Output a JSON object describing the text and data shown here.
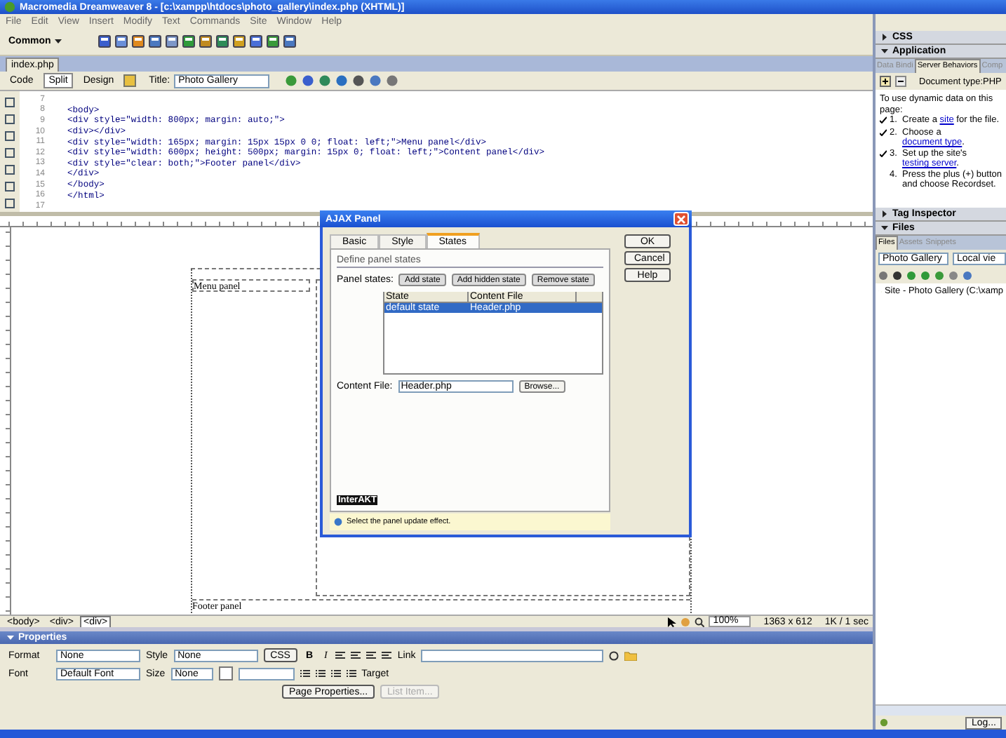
{
  "window": {
    "title": "Macromedia Dreamweaver 8 - [c:\\xampp\\htdocs\\photo_gallery\\index.php (XHTML)]"
  },
  "menu": [
    "File",
    "Edit",
    "View",
    "Insert",
    "Modify",
    "Text",
    "Commands",
    "Site",
    "Window",
    "Help"
  ],
  "insert_bar": {
    "category": "Common"
  },
  "document": {
    "tab": "index.php",
    "views": [
      {
        "label": "Code",
        "selected": false
      },
      {
        "label": "Split",
        "selected": true
      },
      {
        "label": "Design",
        "selected": false
      }
    ],
    "title_label": "Title:",
    "title_value": "Photo Gallery"
  },
  "code_view": {
    "lines": [
      {
        "number": "7"
      },
      {
        "number": "8",
        "text": "<body>"
      },
      {
        "number": "9",
        "text": "<div style=\"width: 800px; margin: auto;\">"
      },
      {
        "number": "10",
        "text": "<div></div>"
      },
      {
        "number": "11",
        "text": "<div style=\"width: 165px; margin: 15px 15px 0 0; float: left;\">Menu panel</div>"
      },
      {
        "number": "12",
        "text": "<div style=\"width: 600px; height: 500px; margin: 15px 0; float: left;\">Content panel</div>"
      },
      {
        "number": "13",
        "text": "<div style=\"clear: both;\">Footer panel</div>"
      },
      {
        "number": "14",
        "text": "</div>"
      },
      {
        "number": "15",
        "text": "</body>"
      },
      {
        "number": "16",
        "text": "</html>"
      },
      {
        "number": "17"
      }
    ]
  },
  "design_view": {
    "menu_panel": "Menu panel",
    "footer_panel": "Footer panel"
  },
  "status_bar": {
    "tags": [
      {
        "label": "<body>",
        "selected": false
      },
      {
        "label": "<div>",
        "selected": false
      },
      {
        "label": "<div>",
        "selected": true
      }
    ],
    "zoom": "100%",
    "window_size": "1363 x 612",
    "download": "1K / 1 sec"
  },
  "properties": {
    "title": "Properties",
    "expanded": true,
    "format_label": "Format",
    "format": "None",
    "style_label": "Style",
    "style": "None",
    "css_button": "CSS",
    "bold": "B",
    "italic": "I",
    "link_label": "Link",
    "font_label": "Font",
    "font": "Default Font",
    "size_label": "Size",
    "size": "None",
    "target_label": "Target",
    "page_properties": "Page Properties...",
    "list_item": {
      "label": "List Item...",
      "disabled": true
    }
  },
  "panels": [
    {
      "title": "CSS",
      "expanded": false
    },
    {
      "kind": "application",
      "title": "Application",
      "expanded": true,
      "tabs": [
        {
          "label": "Data Bindi",
          "selected": false
        },
        {
          "label": "Server Behaviors",
          "selected": true
        },
        {
          "label": "Comp",
          "selected": false
        }
      ],
      "document_type": "Document type:PHP",
      "intro": "To use dynamic data on this page:",
      "steps": [
        {
          "number": "1.",
          "checked": true,
          "before": "Create a ",
          "link": "site",
          "after": " for the file."
        },
        {
          "number": "2.",
          "checked": true,
          "before": "Choose a ",
          "link": "document type",
          "after": "."
        },
        {
          "number": "3.",
          "checked": true,
          "before": "Set up the site's ",
          "link": "testing server",
          "after": "."
        },
        {
          "number": "4.",
          "checked": false,
          "before": "Press the plus (+) button and choose Recordset."
        }
      ]
    },
    {
      "title": "Tag Inspector",
      "expanded": false
    },
    {
      "kind": "files",
      "title": "Files",
      "expanded": true,
      "tabs": [
        {
          "label": "Files",
          "selected": true
        },
        {
          "label": "Assets",
          "selected": false
        },
        {
          "label": "Snippets",
          "selected": false
        }
      ],
      "site": "Photo Gallery",
      "view": "Local vie",
      "tree": [
        {
          "label": "Site - Photo Gallery (C:\\xamp",
          "expanded": false
        }
      ],
      "log_button": "Log..."
    }
  ],
  "dialog": {
    "title": "AJAX Panel",
    "tabs": [
      {
        "label": "Basic",
        "selected": false
      },
      {
        "label": "Style",
        "selected": false
      },
      {
        "label": "States",
        "selected": true
      }
    ],
    "section": "Define panel states",
    "states_label": "Panel states:",
    "actions": [
      "Add state",
      "Add hidden state",
      "Remove state"
    ],
    "columns": [
      "State",
      "Content File"
    ],
    "rows": [
      {
        "cells": [
          "default state",
          "Header.php"
        ],
        "selected": true
      }
    ],
    "content_file_label": "Content File:",
    "content_file": "Header.php",
    "browse": "Browse...",
    "logo": "InterAKT",
    "hint": "Select the panel update effect.",
    "buttons": [
      "OK",
      "Cancel",
      "Help"
    ]
  }
}
